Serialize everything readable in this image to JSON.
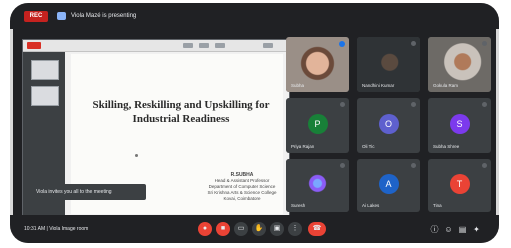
{
  "topbar": {
    "rec_label": "REC",
    "title": "Viola Mazé is presenting"
  },
  "slide": {
    "title": "Skilling, Reskilling and Upskilling for Industrial Readiness",
    "presenter_name": "R.SUBHA",
    "presenter_lines": [
      "Head & Assistant Professor",
      "Department of Computer Science",
      "Sri Krishna Arts & Science College",
      "Kovai, Coimbatore"
    ],
    "toast": "Viola invites you all to the meeting"
  },
  "participants": [
    {
      "name": "Subha",
      "initial": "",
      "color": "#3c4043"
    },
    {
      "name": "Nandhini Kumar",
      "initial": "",
      "color": "#3c4043"
    },
    {
      "name": "Gokula Ram",
      "initial": "",
      "color": "#3c4043"
    },
    {
      "name": "Priya Rajan",
      "initial": "P",
      "color": "#188038"
    },
    {
      "name": "Oli Tic",
      "initial": "O",
      "color": "#5e60ce"
    },
    {
      "name": "Subha Shree",
      "initial": "S",
      "color": "#7c3aed"
    },
    {
      "name": "Suresh",
      "initial": "",
      "color": "#3c4043"
    },
    {
      "name": "Ai Lakes",
      "initial": "A",
      "color": "#1e63c8"
    },
    {
      "name": "Tina",
      "initial": "T",
      "color": "#ea4335"
    }
  ],
  "bottombar": {
    "left_text": "10:31 AM | Viola Image room"
  }
}
